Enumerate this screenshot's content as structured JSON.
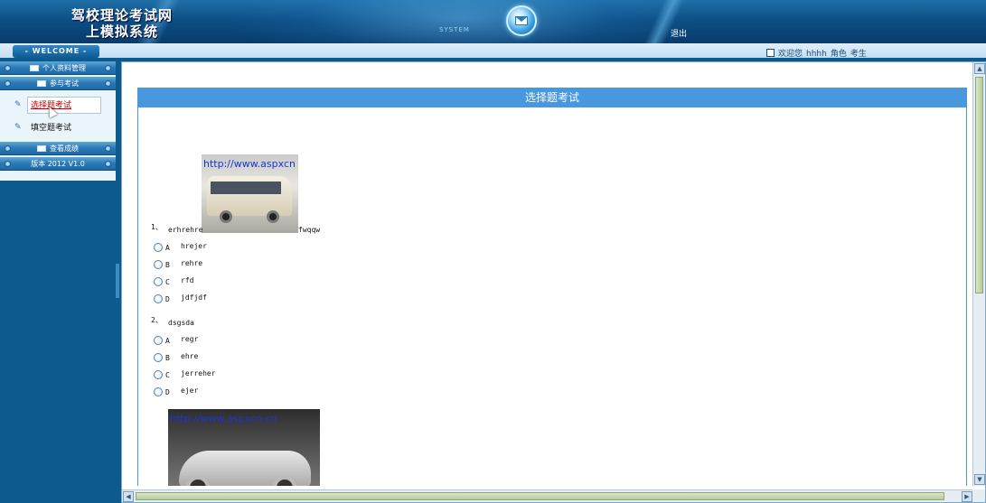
{
  "header": {
    "title_line1": "驾校理论考试网",
    "title_line2": "上模拟系统",
    "system_label": "SYSTEM",
    "logout": "退出"
  },
  "subbar": {
    "welcome": "WELCOME",
    "greeting": "欢迎您",
    "username": "hhhh",
    "role_label": "角色",
    "role": "考生"
  },
  "sidebar": {
    "menus": [
      {
        "label": "个人资料管理"
      },
      {
        "label": "参与考试"
      }
    ],
    "sub_items": [
      {
        "label": "选择题考试",
        "active": true
      },
      {
        "label": "填空题考试",
        "active": false
      }
    ],
    "menus_after": [
      {
        "label": "查看成绩"
      },
      {
        "label": "版本 2012 V1.0"
      }
    ]
  },
  "panel": {
    "title": "选择题考试"
  },
  "questions": [
    {
      "num": "1、",
      "text_before": "erhrehre",
      "text_after": "fwqqw",
      "image_watermark": "http://www.aspxcn",
      "options": [
        {
          "letter": "A",
          "text": "hrejer"
        },
        {
          "letter": "B",
          "text": "rehre"
        },
        {
          "letter": "C",
          "text": "rfd"
        },
        {
          "letter": "D",
          "text": "jdfjdf"
        }
      ]
    },
    {
      "num": "2、",
      "text": "dsgsda",
      "options": [
        {
          "letter": "A",
          "text": "regr"
        },
        {
          "letter": "B",
          "text": "ehre"
        },
        {
          "letter": "C",
          "text": "jerreher"
        },
        {
          "letter": "D",
          "text": "ejer"
        }
      ]
    }
  ],
  "bottom_image": {
    "watermark": "http://www.aspxcn.cn"
  }
}
